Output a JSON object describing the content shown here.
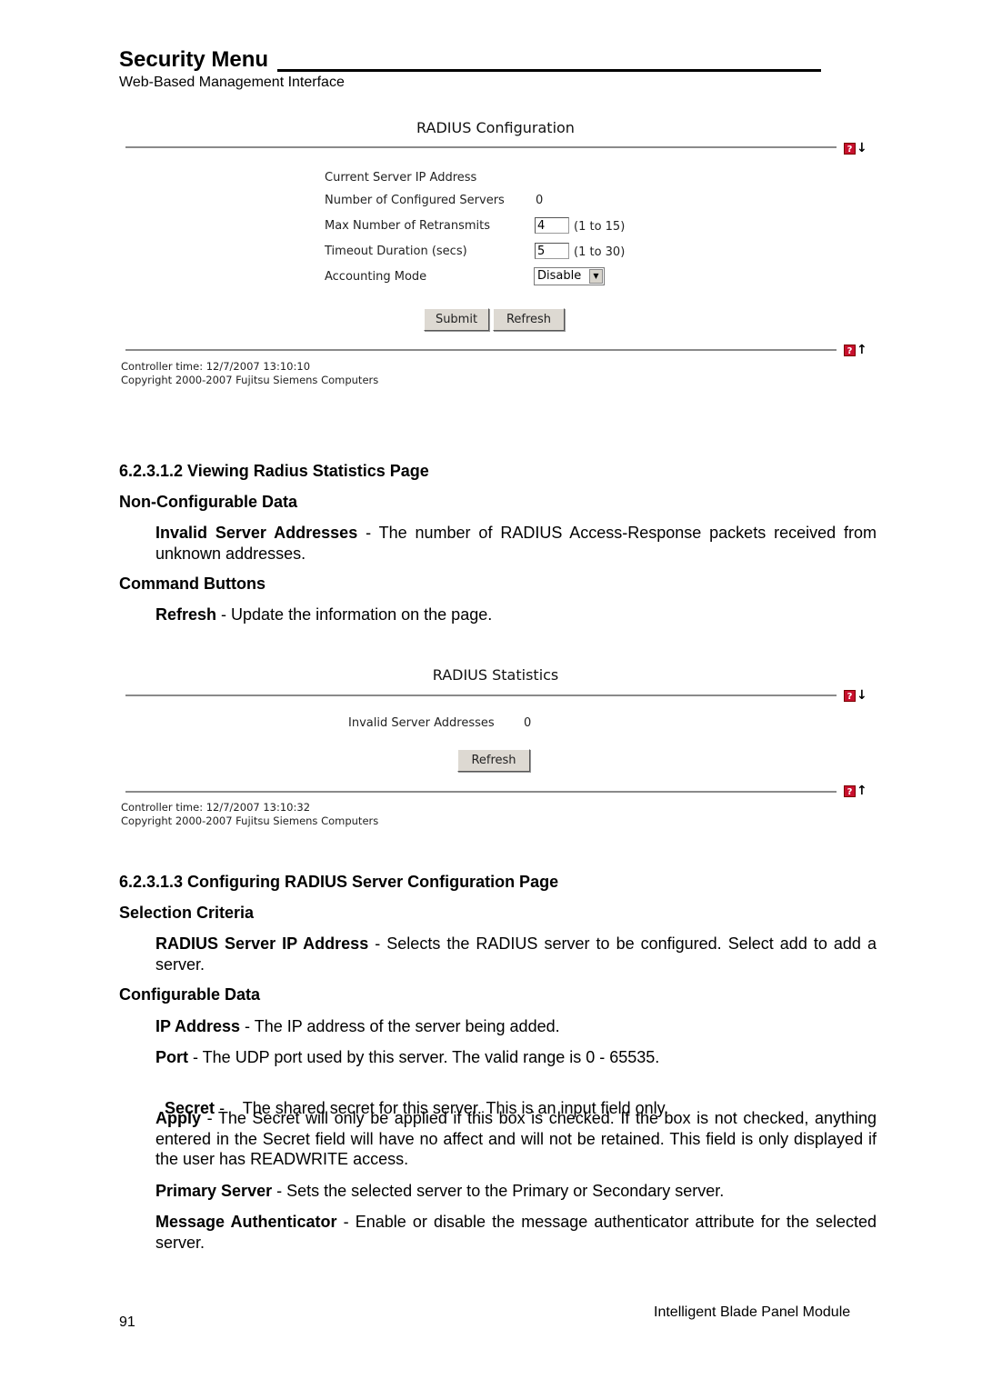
{
  "header": {
    "title": "Security Menu",
    "subtitle": "Web-Based Management Interface"
  },
  "radius_config_panel": {
    "title": "RADIUS Configuration",
    "fields": [
      {
        "label": "Current Server IP Address",
        "value": ""
      },
      {
        "label": "Number of Configured Servers",
        "value": "0"
      },
      {
        "label": "Max Number of Retransmits",
        "value": "4",
        "hint": "(1 to 15)"
      },
      {
        "label": "Timeout Duration (secs)",
        "value": "5",
        "hint": "(1 to 30)"
      },
      {
        "label": "Accounting Mode",
        "value": "Disable"
      }
    ],
    "buttons": {
      "submit": "Submit",
      "refresh": "Refresh"
    },
    "help_glyph": "?",
    "down_arrow": "🡓",
    "up_arrow": "🡑",
    "footer": {
      "controller_time": "Controller time: 12/7/2007 13:10:10",
      "copyright": "Copyright 2000-2007 Fujitsu Siemens Computers"
    }
  },
  "section_6_2_3_1_2": {
    "heading": "6.2.3.1.2   Viewing Radius Statistics Page",
    "sub1": "Non-Configurable Data",
    "item1_term": "Invalid Server Addresses",
    "item1_text": " - The number of RADIUS Access-Response packets received from unknown addresses.",
    "sub2": "Command Buttons",
    "item2_term": "Refresh",
    "item2_text": " - Update the information on the page."
  },
  "radius_stats_panel": {
    "title": "RADIUS Statistics",
    "field_label": "Invalid Server Addresses",
    "field_value": "0",
    "refresh_label": "Refresh",
    "help_glyph": "?",
    "down_arrow": "🡓",
    "up_arrow": "🡑",
    "footer": {
      "controller_time": "Controller time: 12/7/2007 13:10:32",
      "copyright": "Copyright 2000-2007 Fujitsu Siemens Computers"
    }
  },
  "section_6_2_3_1_3": {
    "heading": "6.2.3.1.3   Configuring RADIUS Server Configuration Page",
    "sub1": "Selection Criteria",
    "items1": [
      {
        "term": "RADIUS Server IP Address",
        "text": " - Selects the RADIUS server to be configured. Select add to add a server."
      }
    ],
    "sub2": "Configurable Data",
    "items2": [
      {
        "term": "IP Address",
        "text": " - The IP address of the server being added."
      },
      {
        "term": "Port",
        "text": " - The UDP port used by this server. The valid range is 0 - 65535."
      },
      {
        "term": "Secret",
        "text": " -    The shared secret for this server. This is an input field only."
      },
      {
        "term": "Apply",
        "text": " - The Secret will only be applied if this box is checked. If the box is not checked, anything entered in the Secret field will have no affect and will not be retained. This field is only displayed if the user has READWRITE access."
      },
      {
        "term": "Primary Server",
        "text": " - Sets the selected server to the Primary or Secondary server."
      },
      {
        "term": "Message Authenticator",
        "text": " - Enable or disable the message authenticator attribute for the selected server."
      }
    ]
  },
  "page_footer": {
    "page_number": "91",
    "document_title": "Intelligent Blade Panel Module"
  },
  "colors": {
    "help_icon_red": "#c8102e",
    "rule_gray": "#8a8a8a",
    "button_face": "#ddd9d2"
  }
}
